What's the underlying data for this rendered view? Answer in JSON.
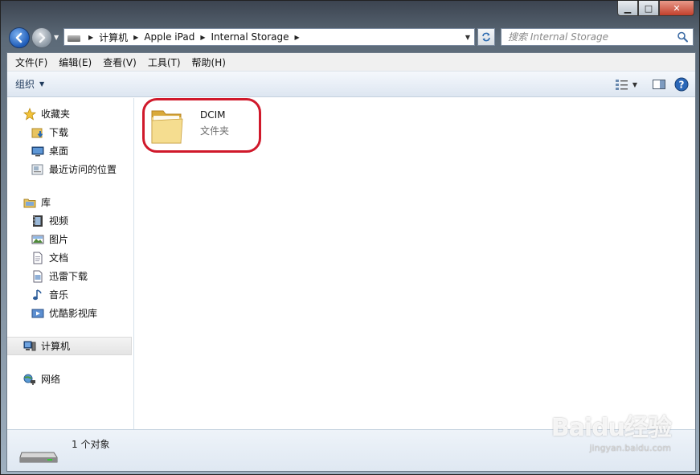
{
  "window": {
    "caption_minimize": "▁",
    "caption_maximize": "□",
    "caption_close": "✕"
  },
  "address": {
    "breadcrumbs": [
      "计算机",
      "Apple iPad",
      "Internal Storage"
    ],
    "search_placeholder": "搜索 Internal Storage"
  },
  "menubar": {
    "items": [
      "文件(F)",
      "编辑(E)",
      "查看(V)",
      "工具(T)",
      "帮助(H)"
    ]
  },
  "toolbar": {
    "organize_label": "组织"
  },
  "sidebar": {
    "favorites": {
      "label": "收藏夹",
      "items": [
        "下载",
        "桌面",
        "最近访问的位置"
      ]
    },
    "libraries": {
      "label": "库",
      "items": [
        "视频",
        "图片",
        "文档",
        "迅雷下载",
        "音乐",
        "优酷影视库"
      ]
    },
    "computer": {
      "label": "计算机"
    },
    "network": {
      "label": "网络"
    }
  },
  "content": {
    "items": [
      {
        "name": "DCIM",
        "type": "文件夹"
      }
    ]
  },
  "details": {
    "count_text": "1 个对象"
  },
  "watermark": {
    "main": "Baidu经验",
    "sub": "jingyan.baidu.com"
  },
  "colors": {
    "highlight_ring": "#d0192b",
    "nav_blue": "#1f5cb8",
    "folder_yellow": "#f2c94c"
  },
  "icons": {
    "back": "left-arrow-icon",
    "forward": "right-arrow-icon",
    "search": "magnifier-icon",
    "help": "question-icon"
  }
}
